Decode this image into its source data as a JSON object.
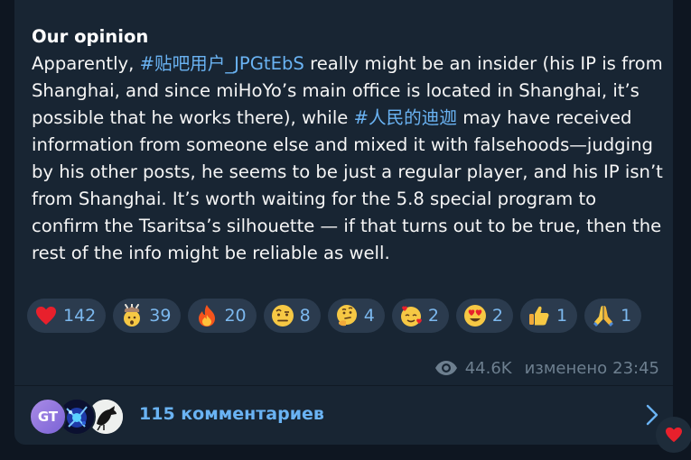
{
  "post": {
    "title": "Our opinion",
    "p1": "Apparently, ",
    "hashtag1": "#贴吧用户_JPGtEbS",
    "p2": " really might be an insider (his IP is from Shanghai, and since miHoYo’s main office is located in Shanghai, it’s possible that he works there), while ",
    "hashtag2": "#人民的迪迦",
    "p3": " may have received information from someone else and mixed it with falsehoods—judging by his other posts, he seems to be just a regular player, and his IP isn’t from Shanghai. It’s worth waiting for the 5.8 special program to confirm the Tsaritsa’s silhouette — if that turns out to be true, then the rest of the info might be reliable as well."
  },
  "reactions": [
    {
      "emoji": "heart-emoji",
      "count": "142"
    },
    {
      "emoji": "exploding-head-emoji",
      "count": "39"
    },
    {
      "emoji": "fire-emoji",
      "count": "20"
    },
    {
      "emoji": "raised-eyebrow-emoji",
      "count": "8"
    },
    {
      "emoji": "thinking-face-emoji",
      "count": "4"
    },
    {
      "emoji": "smiling-face-with-hearts-emoji",
      "count": "2"
    },
    {
      "emoji": "heart-eyes-emoji",
      "count": "2"
    },
    {
      "emoji": "thumbs-up-emoji",
      "count": "1"
    },
    {
      "emoji": "folded-hands-emoji",
      "count": "1"
    }
  ],
  "meta": {
    "icon": "eye-icon",
    "views": "44.6K",
    "edited": "изменено",
    "time": "23:45"
  },
  "comments": {
    "avatar1_initials": "GT",
    "label": "115 комментариев",
    "chevron": "chevron-right-icon"
  },
  "floating_reaction": "heart-emoji",
  "colors": {
    "background": "#0e1621",
    "bubble": "#182533",
    "text": "#f5f5f5",
    "link": "#6ab3f3",
    "reaction_bg": "#2b3b4e",
    "reaction_count": "#7cb8ee",
    "meta": "#6d7f8f",
    "heart": "#e8202c"
  }
}
